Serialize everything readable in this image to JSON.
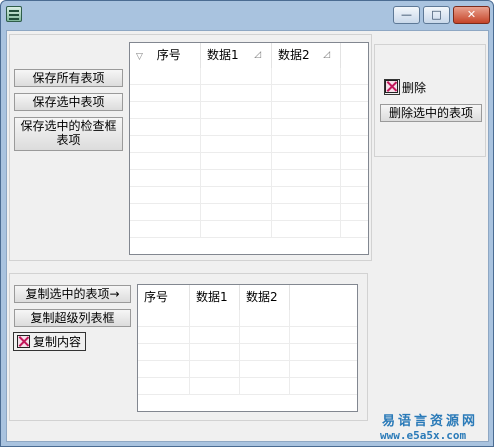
{
  "titlebar": {
    "title": "",
    "min_glyph": "—",
    "max_glyph": "□",
    "close_glyph": "✕"
  },
  "left_buttons": {
    "save_all": "保存所有表项",
    "save_selected": "保存选中表项",
    "save_checked": "保存选中的检查框表项"
  },
  "top_grid": {
    "sort_glyph": "▽",
    "sort_glyph_2": "◿",
    "columns": [
      "序号",
      "数据1",
      "数据2"
    ],
    "row_count": 10
  },
  "right_panel": {
    "delete_checkbox_label": "删除",
    "delete_selected": "删除选中的表项"
  },
  "bottom_buttons": {
    "copy_selected": "复制选中的表项→",
    "copy_super": "复制超级列表框",
    "copy_content_label": "复制内容"
  },
  "bottom_grid": {
    "columns": [
      "序号",
      "数据1",
      "数据2"
    ],
    "row_count": 5
  },
  "watermark": {
    "line1": "易语言资源网",
    "line2": "www.e5a5x.com"
  }
}
